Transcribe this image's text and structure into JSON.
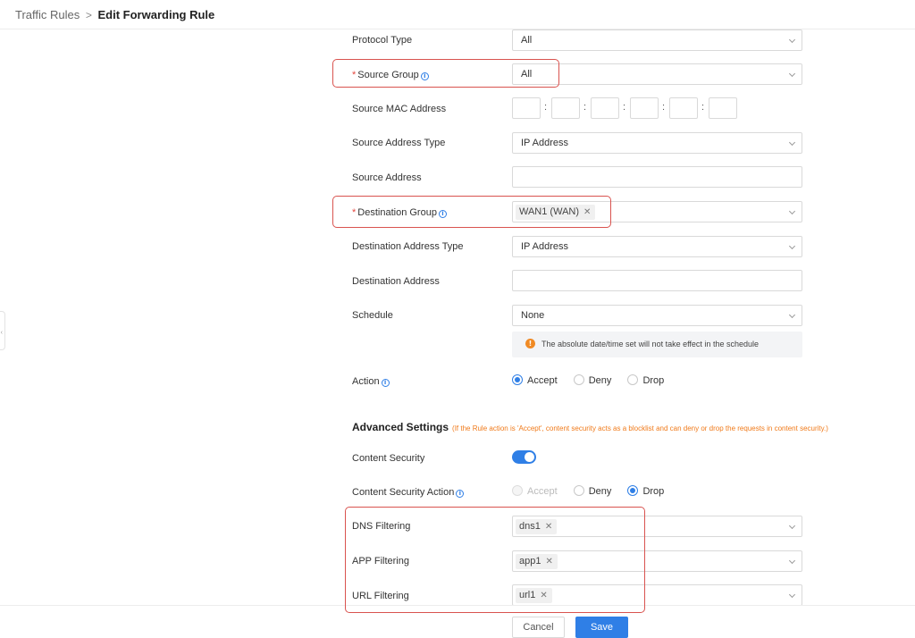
{
  "breadcrumb": {
    "parent": "Traffic Rules",
    "separator": ">",
    "current": "Edit Forwarding Rule"
  },
  "form": {
    "protocol_type": {
      "label": "Protocol Type",
      "value": "All"
    },
    "source_group": {
      "required_mark": "*",
      "label": "Source Group",
      "value": "All"
    },
    "source_mac": {
      "label": "Source MAC Address",
      "separator": ":"
    },
    "source_address_type": {
      "label": "Source Address Type",
      "value": "IP Address"
    },
    "source_address": {
      "label": "Source Address",
      "value": ""
    },
    "destination_group": {
      "required_mark": "*",
      "label": "Destination Group",
      "tag": "WAN1 (WAN)"
    },
    "destination_address_type": {
      "label": "Destination Address Type",
      "value": "IP Address"
    },
    "destination_address": {
      "label": "Destination Address",
      "value": ""
    },
    "schedule": {
      "label": "Schedule",
      "value": "None",
      "notice": "The absolute date/time set will not take effect in the schedule"
    },
    "action": {
      "label": "Action",
      "options": [
        "Accept",
        "Deny",
        "Drop"
      ],
      "selected": "Accept"
    }
  },
  "advanced": {
    "title": "Advanced Settings",
    "note": "(If the Rule action is 'Accept', content security acts as a blocklist and can deny or drop the requests in content security.)",
    "content_security": {
      "label": "Content Security",
      "enabled": true
    },
    "content_security_action": {
      "label": "Content Security Action",
      "options": [
        "Accept",
        "Deny",
        "Drop"
      ],
      "selected": "Drop",
      "disabled": [
        "Accept"
      ]
    },
    "dns_filtering": {
      "label": "DNS Filtering",
      "tag": "dns1"
    },
    "app_filtering": {
      "label": "APP Filtering",
      "tag": "app1"
    },
    "url_filtering": {
      "label": "URL Filtering",
      "tag": "url1"
    }
  },
  "footer": {
    "cancel_label": "Cancel",
    "save_label": "Save"
  },
  "colors": {
    "accent": "#2f7fe6",
    "required": "#e5473f",
    "highlight": "#d9534f",
    "note": "#f07a1a"
  },
  "icons": {
    "info": "info-circle-icon",
    "warning": "warning-circle-icon",
    "dropdown": "chevron-down-icon",
    "tag_remove": "close-icon"
  }
}
